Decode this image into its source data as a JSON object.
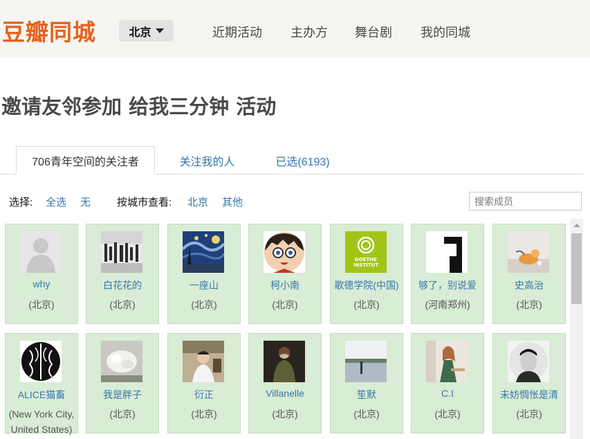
{
  "header": {
    "logo": "豆瓣同城",
    "city": "北京",
    "nav": [
      "近期活动",
      "主办方",
      "舞台剧",
      "我的同城"
    ]
  },
  "page_title": "邀请友邻参加 给我三分钟 活动",
  "tabs": [
    "706青年空间的关注者",
    "关注我的人",
    "已选(6193)"
  ],
  "filter": {
    "select_label": "选择:",
    "select_all": "全选",
    "select_none": "无",
    "city_label": "按城市查看:",
    "city_beijing": "北京",
    "city_other": "其他",
    "search_placeholder": "搜索成员"
  },
  "members": [
    {
      "name": "why",
      "city": "(北京)"
    },
    {
      "name": "白花花的",
      "city": "(北京)"
    },
    {
      "name": "一座山",
      "city": "(北京)"
    },
    {
      "name": "柯小南",
      "city": "(北京)"
    },
    {
      "name": "歌德学院(中国)",
      "city": "(北京)"
    },
    {
      "name": "够了，别说爱",
      "city": "(河南郑州)"
    },
    {
      "name": "史高治",
      "city": "(北京)"
    },
    {
      "name": "ALICE猫畜",
      "city": "(New York City, United States)"
    },
    {
      "name": "我是胖子",
      "city": "(北京)"
    },
    {
      "name": "衍正",
      "city": "(北京)"
    },
    {
      "name": "Villanelle",
      "city": "(北京)"
    },
    {
      "name": "笙默",
      "city": "(北京)"
    },
    {
      "name": "C.I",
      "city": "(北京)"
    },
    {
      "name": "未妨惆怅是清",
      "city": "(北京)"
    }
  ],
  "goethe_logo_text": "GOETHE INSTITUT"
}
